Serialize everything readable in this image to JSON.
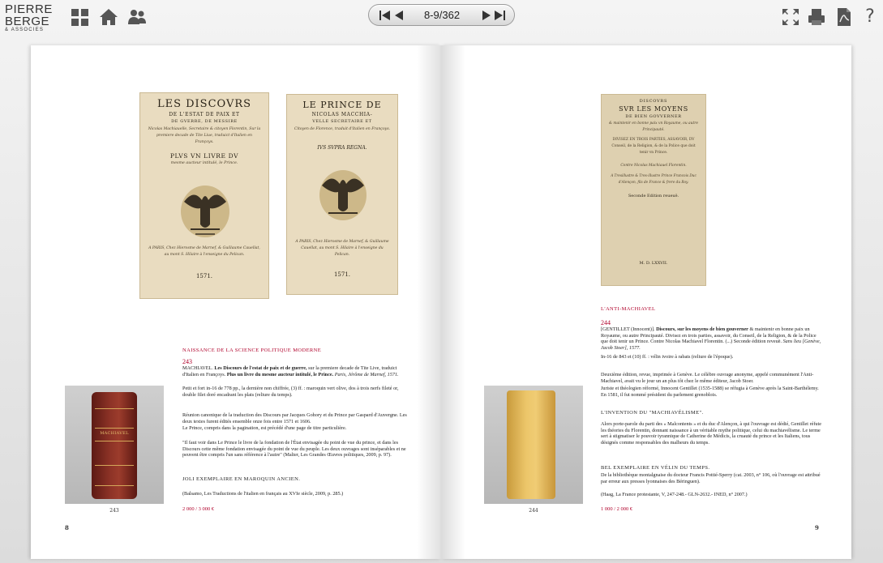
{
  "toolbar": {
    "logo_line1": "PIERRE",
    "logo_line2": "BERGE",
    "logo_line3": "& ASSOCIES",
    "page_indicator": "8-9/362",
    "icons": [
      "grid-icon",
      "home-icon",
      "users-icon",
      "first-page-icon",
      "prev-page-icon",
      "next-page-icon",
      "last-page-icon",
      "fullscreen-icon",
      "print-icon",
      "pdf-icon",
      "help-icon"
    ],
    "help_label": "?"
  },
  "left_page": {
    "title_page_1": {
      "line1": "LES DISCOVRS",
      "line2": "DE L'ESTAT DE PAIX ET",
      "line3": "DE GVERRE, DE MESSIRE",
      "line4": "Nicolas Machiauelle, Secretaire & citoyen Florentin, Sur la premiere decade de Tite Liue, traduict d'Italien en Françoys.",
      "line5": "PLVS VN LIVRE DV",
      "line6": "mesme aucteur intitulé, le Prince.",
      "imprint": "A PARIS, Chez Hierosme de Marnef, & Guillaume Cauellat, au mont S. Hilaire à l'enseigne du Pelican.",
      "year": "1571."
    },
    "title_page_2": {
      "line1": "LE PRINCE DE",
      "line2": "NICOLAS MACCHIA-",
      "line3": "VELLE SECRETAIRE ET",
      "line4": "Citoyen de Florence, traduit d'Italien en Françoys.",
      "motto": "IVS SVPRA REGNA.",
      "imprint": "A PARIS, Chez Hierosme de Marnef, & Guillaume Cauellat, au mont S. Hilaire à l'enseigne du Pelican.",
      "year": "1571."
    },
    "spine_label": "MACHIAVEL",
    "section_title": "Naissance de la science politique moderne",
    "lot_number": "243",
    "author": "MACHIAVEL.",
    "title_bold": "Les Discours de l'estat de paix et de guerre,",
    "desc_a": "sur la premiere decade de Tite Live, traduict d'Italien en Françoys.",
    "title_bold_2": "Plus un livre du mesme aucteur intitulé, le Prince.",
    "imprint": "Paris, Jérôme de Marnef, 1571.",
    "collation": "Petit et fort in-16 de 778 pp., la dernière non chiffrée, (3) ff. : maroquin vert olive, dos à trois nerfs fileté or, double filet doré encadrant les plats (reliure du temps).",
    "para1": "Réunion canonique de la traduction des Discours par Jacques Gohory et du Prince par Gaspard d'Auvergne. Les deux textes furent édités ensemble onze fois entre 1571 et 1606.",
    "para1b": "Le Prince, compris dans la pagination, est précédé d'une page de titre particulière.",
    "quote": "\"Il faut voir dans Le Prince le livre de la fondation de l'État envisagée du point de vue du prince, et dans les Discours cette même fondation envisagée du point de vue du peuple. Les deux ouvrages sont inséparables et ne peuvent être compris l'un sans référence à l'autre\" (Malter, Les Grandes Œuvres politiques, 2009, p. 97).",
    "binding_note": "Joli exemplaire en maroquin ancien.",
    "reference": "(Balsamo, Les Traductions de l'italien en français au XVIe siècle, 2009, p. 285.)",
    "estimate": "2 000 / 3 000 €",
    "photo_caption": "243",
    "page_number": "8"
  },
  "right_page": {
    "title_page": {
      "line1": "DISCOVRS",
      "line2": "SVR LES MOYENS",
      "line3": "DE BIEN GOVVERNER",
      "line4": "& maintenir en bonne paix vn Royaume, ou autre Principauté.",
      "line5": "DIVISEZ EN TROIS PARTIES, ASSAVOIR, DV Conseil, de la Religion, & de la Police que doit tenir vn Prince.",
      "line6": "Contre Nicolas Machiauel Florentin.",
      "line7": "A Tresillustre & Tres-illustre Prince Francois Duc d'Alençon, fils de France & frere du Roy.",
      "line8": "Seconde Edition reueuë.",
      "year": "M. D. LXXVII."
    },
    "section_title": "L'Anti-Machiavel",
    "lot_number": "244",
    "author": "[GENTILLET (Innocent)].",
    "title_bold": "Discours, sur les moyens de bien gouverner",
    "desc_a": "& maintenir en bonne paix un Royaume, ou autre Principauté. Divisez en trois parties, assavoir, du Conseil, de la Religion, & de la Police que doit tenir un Prince. Contre Nicolas Machiavel Florentin. (...) Seconde édition reveuë.",
    "imprint": "Sans lieu [Genève, Jacob Stoer], 1577.",
    "collation": "In-16 de 843 et (10) ff. : vélin ivoire à rabats (reliure de l'époque).",
    "para1": "Deuxième édition, revue, imprimée à Genève. Le célèbre ouvrage anonyme, appelé communément l'Anti-Machiavel, avait vu le jour un an plus tôt chez le même éditeur, Jacob Stoer.",
    "para2": "Juriste et théologien réformé, Innocent Gentillet (1535-1588) se réfugia à Genève après la Saint-Barthélemy. En 1581, il fut nommé président du parlement grenoblois.",
    "sub_title": "L'invention du \"machiavélisme\".",
    "para3": "Alors porte-parole du parti des « Malcontents » et du duc d'Alençon, à qui l'ouvrage est dédié, Gentillet réfute les théories du Florentin, donnant naissance à un véritable mythe politique, celui du machiavélisme. Le terme sert à stigmatiser le pouvoir tyrannique de Catherine de Médicis, la cruauté du prince et les Italiens, tous désignés comme responsables des malheurs du temps.",
    "sub_title_2": "Bel exemplaire en vélin du temps.",
    "para4": "De la bibliothèque montalgnaise du docteur Francis Pottié-Sperry (cat. 2003, n° 106, où l'ouvrage est attribué par erreur aux presses lyonnaises des Béringuen).",
    "reference": "(Haag, La France protestante, V, 247-248.- GLN-2632.- INED, n° 2007.)",
    "estimate": "1 000 / 2 000 €",
    "photo_caption": "244",
    "page_number": "9"
  }
}
